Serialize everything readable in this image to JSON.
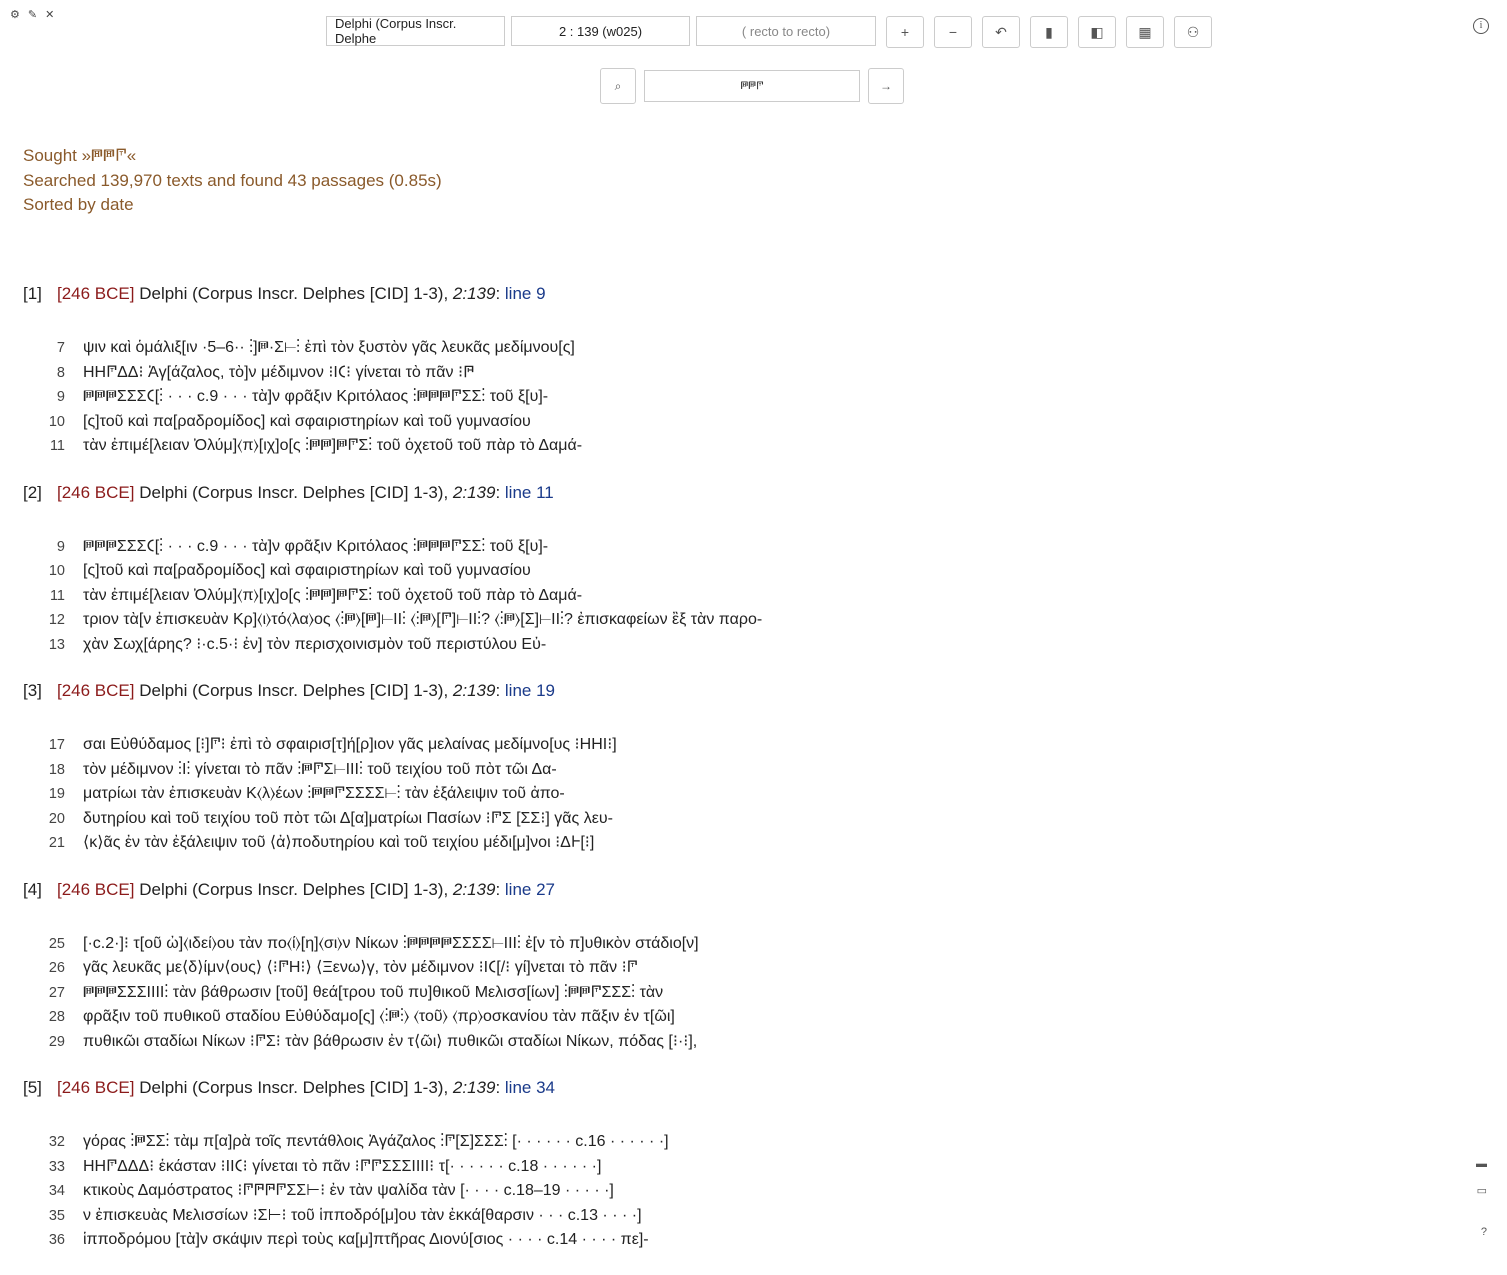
{
  "toolbar": {
    "corpus_value": "Delphi (Corpus Inscr. Delphe",
    "ref_value": "2 : 139 (w025)",
    "orientation_value": "(  recto to recto)",
    "buttons": [
      "+",
      "−",
      "↶",
      "▮",
      "◧",
      "▦",
      "⚇"
    ]
  },
  "search": {
    "query": "𐅅𐅅𐅈",
    "search_icon": "⌕",
    "go_icon": "→"
  },
  "summary": {
    "sought": "Sought »𐅅𐅅𐅈«",
    "searched": "Searched 139,970 texts and found 43 passages (0.85s)",
    "sorted": "Sorted by date"
  },
  "results": [
    {
      "num": "[1]",
      "date": "[246 BCE]",
      "place": " Delphi (Corpus Inscr. Delphes [CID] 1-3), ",
      "ref": "2:139",
      "line": "line 9",
      "lines": [
        {
          "n": "7",
          "t": "ψιν καὶ ὁμάλιξ[ιν ·5–6·· ⁝]𐅅·Σ⊢⁝ ἐπὶ τὸν ξυστὸν γᾶς λευκᾶς μεδίμνου[ς]"
        },
        {
          "n": "8",
          "t": "ΗΗ𐅈ΔΔ⁝ Ἀγ[άζαλος, τὸ]ν μέδιμνον ⁝Ι𐅁⁝ γίνεται τὸ πᾶν ⁝𐅅"
        },
        {
          "n": "9",
          "t": "𐅅𐅅𐅅ΣΣΣ𐅁[⁝ · · · c.9 · · · τὰ]ν φρᾶξιν Κριτόλαος ⁝𐅅𐅅𐅅𐅈ΣΣ⁝ τοῦ ξ[υ]-"
        },
        {
          "n": "10",
          "t": "[ς]τοῦ καὶ πα[ραδρομίδος] καὶ σφαιριστηρίων καὶ τοῦ γυμνασίου"
        },
        {
          "n": "11",
          "t": "τὰν ἐπιμέ[λειαν Ὀλύμ]⟨π⟩[ιχ]ο[ς ⁝𐅅𐅅]𐅅𐅈Σ⁝ τοῦ ὀχετοῦ τοῦ πὰρ τὸ Δαμά-"
        }
      ]
    },
    {
      "num": "[2]",
      "date": "[246 BCE]",
      "place": " Delphi (Corpus Inscr. Delphes [CID] 1-3), ",
      "ref": "2:139",
      "line": "line 11",
      "lines": [
        {
          "n": "9",
          "t": "𐅅𐅅𐅅ΣΣΣ𐅁[⁝ · · · c.9 · · · τὰ]ν φρᾶξιν Κριτόλαος ⁝𐅅𐅅𐅅𐅈ΣΣ⁝ τοῦ ξ[υ]-"
        },
        {
          "n": "10",
          "t": "[ς]τοῦ καὶ πα[ραδρομίδος] καὶ σφαιριστηρίων καὶ τοῦ γυμνασίου"
        },
        {
          "n": "11",
          "t": "τὰν ἐπιμέ[λειαν Ὀλύμ]⟨π⟩[ιχ]ο[ς ⁝𐅅𐅅]𐅅𐅈Σ⁝ τοῦ ὀχετοῦ τοῦ πὰρ τὸ Δαμά-"
        },
        {
          "n": "12",
          "t": "τριον τὰ[ν ἐπισκευὰν Κρ]⟨ι⟩τό⟨λα⟩ος ⟨⁝𐅅⟩[𐅅]⊢ΙΙ⁝ ⟨⁝𐅅⟩[𐅈]⊢ΙΙ⁝? ⟨⁝𐅅⟩[Σ]⊢ΙΙ⁝? ἐπισκαφείων ἒξ τὰν παρο-"
        },
        {
          "n": "13",
          "t": "χὰν Σωχ[άρης? ⁝·c.5·⁝ ἐν] τὸν περισχοινισμὸν τοῦ περιστύλου Εὐ-"
        }
      ]
    },
    {
      "num": "[3]",
      "date": "[246 BCE]",
      "place": " Delphi (Corpus Inscr. Delphes [CID] 1-3), ",
      "ref": "2:139",
      "line": "line 19",
      "lines": [
        {
          "n": "17",
          "t": "σαι Εὐθύδαμος [⁝]𐅈⁝ ἐπὶ τὸ σφαιρισ[τ]ή[ρ]ιον γᾶς μελαίνας μεδίμνο[υς ⁝ΗΗΙ⁝]"
        },
        {
          "n": "18",
          "t": "τὸν μέδιμνον ⁝Ι⁝ γίνεται τὸ πᾶν ⁝𐅅𐅈Σ⊢ΙΙΙ⁝ τοῦ τειχίου τοῦ πὸτ τῶι Δα-"
        },
        {
          "n": "19",
          "t": "ματρίωι τὰν ἐπισκευὰν Κ⟨λ⟩έων ⁝𐅅𐅅𐅈ΣΣΣΣ⊢⁝ τὰν ἐξάλειψιν τοῦ ἀπο-"
        },
        {
          "n": "20",
          "t": "δυτηρίου καὶ τοῦ τειχίου τοῦ πὸτ τῶι Δ[α]ματρίωι Πασίων ⁝𐅈Σ [ΣΣ⁝] γᾶς λευ-"
        },
        {
          "n": "21",
          "t": "⟨κ⟩ᾶς ἐν τὰν ἐξάλειψιν τοῦ ⟨ἀ⟩ποδυτηρίου καὶ τοῦ τειχίου μέδι[μ]νοι ⁝Δ𐅂[⁝]"
        }
      ]
    },
    {
      "num": "[4]",
      "date": "[246 BCE]",
      "place": " Delphi (Corpus Inscr. Delphes [CID] 1-3), ",
      "ref": "2:139",
      "line": "line 27",
      "lines": [
        {
          "n": "25",
          "t": "[·c.2·]⁝ τ[οῦ ὠ]⟨ιδεί⟩ου τὰν πο⟨ί⟩[η]⟨σι⟩ν Νίκων ⁝𐅅𐅅𐅅𐅅ΣΣΣΣ⊢ΙΙΙ⁝ ἐ[ν τὸ π]υθικὸν στάδιο[ν]"
        },
        {
          "n": "26",
          "t": "γᾶς λευκᾶς με⟨δ⟩ίμν⟨ους⟩ ⟨⁝𐅈Η⁝⟩ ⟨Ξενω⟩γ, τὸν μέδιμνον ⁝Ι𐅁[/⁝ γί]νεται τὸ πᾶν ⁝𐅈"
        },
        {
          "n": "27",
          "t": "𐅅𐅅𐅅ΣΣΣΙΙΙΙ⁝ τὰν βάθρωσιν [τοῦ] θεά[τρου τοῦ πυ]θικοῦ Μελισσ[ίων] ⁝𐅅𐅅𐅈ΣΣΣ⁝ τὰν"
        },
        {
          "n": "28",
          "t": "φρᾶξιν τοῦ πυθικοῦ σταδίου Εὐθύδαμο[ς] ⟨⁝𐅅⁝⟩ ⟨τοῦ⟩ ⟨πρ⟩οσκανίου τὰν πᾶξιν ἐν τ[ῶι]"
        },
        {
          "n": "29",
          "t": "πυθικῶι σταδίωι Νίκων ⁝𐅈Σ⁝ τὰν βάθρωσιν ἐν τ⟨ῶι⟩ πυθικῶι σταδίωι Νίκων, πόδας [⁝·⁝],"
        }
      ]
    },
    {
      "num": "[5]",
      "date": "[246 BCE]",
      "place": " Delphi (Corpus Inscr. Delphes [CID] 1-3), ",
      "ref": "2:139",
      "line": "line 34",
      "lines": [
        {
          "n": "32",
          "t": "γόρας ⁝𐅅ΣΣ⁝ τὰμ π[α]ρὰ τοῖς πεντάθλοις Ἀγάζαλος ⁝𐅈[Σ]ΣΣΣ⁝ [· · · · · · c.16 · · · · · ·]"
        },
        {
          "n": "33",
          "t": "ΗΗ𐅈ΔΔΔ⁝ ἑκάσταν ⁝ΙΙ𐅁⁝ γίνεται τὸ πᾶν ⁝𐅈𐅈ΣΣΣΙΙΙΙ⁝ τ[· · · · · · c.18 · · · · · ·]"
        },
        {
          "n": "34",
          "t": "κτικοὺς Δαμόστρατος ⁝𐅈𐅅𐅅𐅈ΣΣ⊢⁝ ἐν τὰν ψαλίδα τὰν [· · · · c.18–19 · · · · ·]"
        },
        {
          "n": "35",
          "t": "ν ἐπισκευὰς Μελισσίων ⁝Σ⊢⁝ τοῦ ἱπποδρό[μ]ου τὰν ἐκκά[θαρσιν · · · c.13 · · · ·]"
        },
        {
          "n": "36",
          "t": "ἱπποδρόμου [τὰ]ν σκάψιν περὶ τοὺς κα[μ]πτῆρας Διονύ[σιος · · · · c.14 · · · · πε]-"
        }
      ]
    }
  ]
}
